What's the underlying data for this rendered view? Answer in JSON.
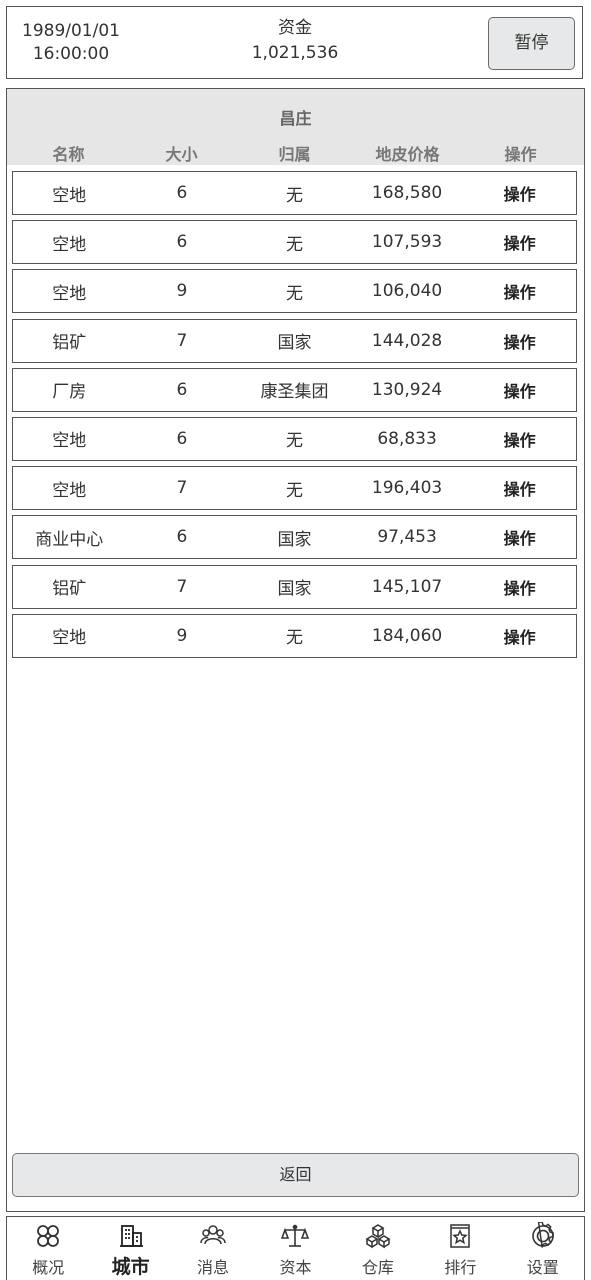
{
  "header": {
    "date": "1989/01/01",
    "time": "16:00:00",
    "funds_label": "资金",
    "funds_value": "1,021,536",
    "pause_label": "暂停"
  },
  "table": {
    "city": "昌庄",
    "columns": [
      "名称",
      "大小",
      "归属",
      "地皮价格",
      "操作"
    ],
    "rows": [
      {
        "name": "空地",
        "size": "6",
        "owner": "无",
        "price": "168,580",
        "action": "操作"
      },
      {
        "name": "空地",
        "size": "6",
        "owner": "无",
        "price": "107,593",
        "action": "操作"
      },
      {
        "name": "空地",
        "size": "9",
        "owner": "无",
        "price": "106,040",
        "action": "操作"
      },
      {
        "name": "铝矿",
        "size": "7",
        "owner": "国家",
        "price": "144,028",
        "action": "操作"
      },
      {
        "name": "厂房",
        "size": "6",
        "owner": "康圣集团",
        "price": "130,924",
        "action": "操作"
      },
      {
        "name": "空地",
        "size": "6",
        "owner": "无",
        "price": "68,833",
        "action": "操作"
      },
      {
        "name": "空地",
        "size": "7",
        "owner": "无",
        "price": "196,403",
        "action": "操作"
      },
      {
        "name": "商业中心",
        "size": "6",
        "owner": "国家",
        "price": "97,453",
        "action": "操作"
      },
      {
        "name": "铝矿",
        "size": "7",
        "owner": "国家",
        "price": "145,107",
        "action": "操作"
      },
      {
        "name": "空地",
        "size": "9",
        "owner": "无",
        "price": "184,060",
        "action": "操作"
      }
    ]
  },
  "back_label": "返回",
  "nav": {
    "active": "city",
    "items": [
      {
        "id": "overview",
        "label": "概况",
        "icon": "overview-icon"
      },
      {
        "id": "city",
        "label": "城市",
        "icon": "city-icon"
      },
      {
        "id": "messages",
        "label": "消息",
        "icon": "messages-icon"
      },
      {
        "id": "capital",
        "label": "资本",
        "icon": "capital-icon"
      },
      {
        "id": "warehouse",
        "label": "仓库",
        "icon": "warehouse-icon"
      },
      {
        "id": "ranking",
        "label": "排行",
        "icon": "ranking-icon"
      },
      {
        "id": "settings",
        "label": "设置",
        "icon": "settings-icon"
      }
    ]
  }
}
